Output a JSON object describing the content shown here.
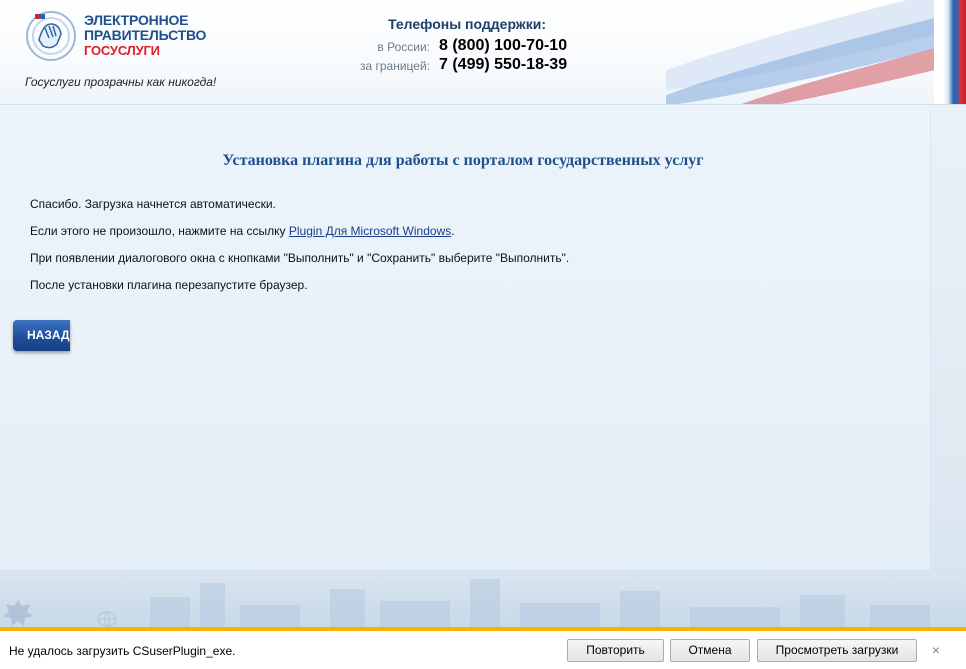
{
  "header": {
    "brand_line1": "ЭЛЕКТРОННОЕ",
    "brand_line2": "ПРАВИТЕЛЬСТВО",
    "brand_line3": "ГОСУСЛУГИ",
    "slogan": "Госуслуги прозрачны как никогда!",
    "phones_title": "Телефоны поддержки:",
    "phones": [
      {
        "label": "в России:",
        "number": "8 (800) 100-70-10"
      },
      {
        "label": "за границей:",
        "number": "7 (499) 550-18-39"
      }
    ]
  },
  "content": {
    "title": "Установка плагина для работы с порталом государственных услуг",
    "line1": "Спасибо. Загрузка начнется автоматически.",
    "line2_prefix": "Если этого не произошло, нажмите на ссылку ",
    "line2_link": "Plugin Для Microsoft Windows",
    "line2_suffix": ".",
    "line3": "При появлении диалогового окна с кнопками \"Выполнить\" и \"Сохранить\" выберите \"Выполнить\".",
    "line4": "После установки плагина перезапустите браузер.",
    "back_label": "НАЗАД"
  },
  "download_bar": {
    "message": "Не удалось загрузить CSuserPlugin_exe.",
    "retry_label": "Повторить",
    "cancel_label": "Отмена",
    "view_downloads_label": "Просмотреть загрузки",
    "close_glyph": "×"
  },
  "colors": {
    "brand_blue": "#1f4f8f",
    "brand_red": "#d8232a",
    "button_blue": "#1f4f9c",
    "bar_accent": "#f5b400"
  }
}
